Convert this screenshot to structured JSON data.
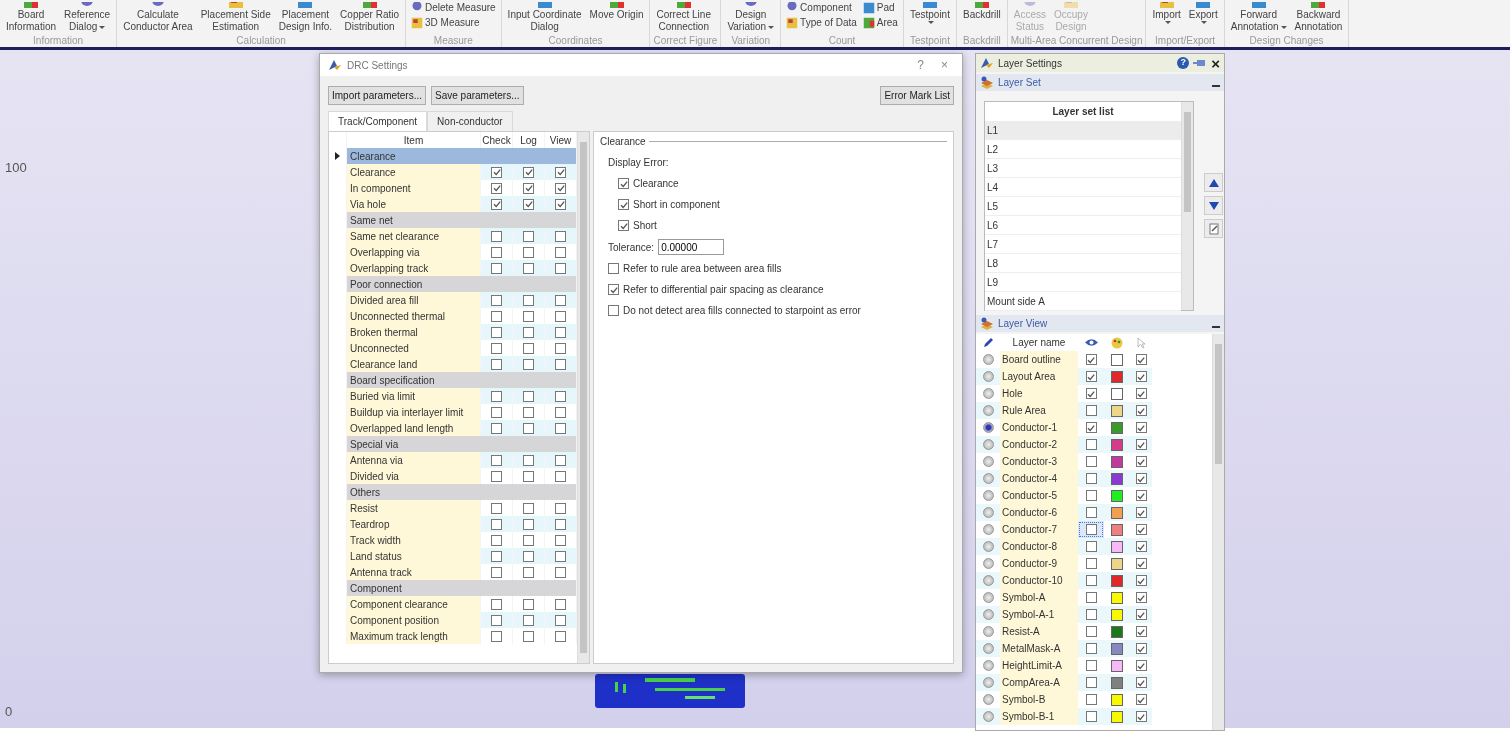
{
  "ribbon": {
    "groups": [
      {
        "title": "Information",
        "buttons": [
          {
            "kind": "large",
            "lines": [
              "Board",
              "Information"
            ],
            "dropdown": false,
            "disabled": false
          },
          {
            "kind": "large",
            "lines": [
              "Reference",
              "Dialog"
            ],
            "dropdown": true,
            "disabled": false
          }
        ]
      },
      {
        "title": "Calculation",
        "buttons": [
          {
            "kind": "large",
            "lines": [
              "Calculate",
              "Conductor Area"
            ],
            "dropdown": false,
            "disabled": false
          },
          {
            "kind": "large",
            "lines": [
              "Placement Side",
              "Estimation"
            ],
            "dropdown": false,
            "disabled": false
          },
          {
            "kind": "large",
            "lines": [
              "Placement",
              "Design Info."
            ],
            "dropdown": false,
            "disabled": false
          },
          {
            "kind": "large",
            "lines": [
              "Copper Ratio",
              "Distribution"
            ],
            "dropdown": false,
            "disabled": false
          }
        ]
      },
      {
        "title": "Measure",
        "buttons": [
          {
            "kind": "small",
            "lines": [
              "Delete Measure"
            ],
            "dropdown": false,
            "disabled": false
          },
          {
            "kind": "small",
            "lines": [
              "3D Measure"
            ],
            "dropdown": false,
            "disabled": false
          }
        ]
      },
      {
        "title": "Coordinates",
        "buttons": [
          {
            "kind": "large",
            "lines": [
              "Input Coordinate",
              "Dialog"
            ],
            "dropdown": false,
            "disabled": false
          },
          {
            "kind": "large",
            "lines": [
              "Move Origin"
            ],
            "dropdown": false,
            "disabled": false
          }
        ]
      },
      {
        "title": "Correct Figure",
        "buttons": [
          {
            "kind": "large",
            "lines": [
              "Correct Line",
              "Connection"
            ],
            "dropdown": false,
            "disabled": false
          }
        ]
      },
      {
        "title": "Variation",
        "buttons": [
          {
            "kind": "large",
            "lines": [
              "Design",
              "Variation"
            ],
            "dropdown": true,
            "disabled": false
          }
        ]
      },
      {
        "title": "Count",
        "buttons": [
          {
            "kind": "small",
            "lines": [
              "Component"
            ],
            "dropdown": false,
            "disabled": false
          },
          {
            "kind": "small",
            "lines": [
              "Type of Data"
            ],
            "dropdown": false,
            "disabled": false
          },
          {
            "kind": "small",
            "lines": [
              "Pad"
            ],
            "dropdown": false,
            "disabled": false
          },
          {
            "kind": "small",
            "lines": [
              "Area"
            ],
            "dropdown": false,
            "disabled": false
          }
        ]
      },
      {
        "title": "Testpoint",
        "buttons": [
          {
            "kind": "large",
            "lines": [
              "Testpoint"
            ],
            "dropdown": true,
            "disabled": false
          }
        ]
      },
      {
        "title": "Backdrill",
        "buttons": [
          {
            "kind": "large",
            "lines": [
              "Backdrill"
            ],
            "dropdown": false,
            "disabled": false
          }
        ]
      },
      {
        "title": "Multi-Area Concurrent Design",
        "buttons": [
          {
            "kind": "large",
            "lines": [
              "Access",
              "Status"
            ],
            "dropdown": false,
            "disabled": true
          },
          {
            "kind": "large",
            "lines": [
              "Occupy",
              "Design"
            ],
            "dropdown": false,
            "disabled": true
          }
        ]
      },
      {
        "title": "Import/Export",
        "buttons": [
          {
            "kind": "large",
            "lines": [
              "Import"
            ],
            "dropdown": true,
            "disabled": false
          },
          {
            "kind": "large",
            "lines": [
              "Export"
            ],
            "dropdown": true,
            "disabled": false
          }
        ]
      },
      {
        "title": "Design Changes",
        "buttons": [
          {
            "kind": "large",
            "lines": [
              "Forward",
              "Annotation"
            ],
            "dropdown": true,
            "disabled": false
          },
          {
            "kind": "large",
            "lines": [
              "Backward",
              "Annotation"
            ],
            "dropdown": false,
            "disabled": false
          }
        ]
      }
    ]
  },
  "canvas": {
    "ruler_labels": [
      "100",
      "0"
    ]
  },
  "drc_dialog": {
    "title": "DRC Settings",
    "help": "?",
    "close": "×",
    "buttons": [
      {
        "label": "Import parameters..."
      },
      {
        "label": "Save parameters..."
      }
    ],
    "error_mark_button": "Error Mark List",
    "tabs": [
      {
        "label": "Track/Component",
        "selected": true
      },
      {
        "label": "Non-conductor",
        "selected": false
      }
    ],
    "columns": [
      "Item",
      "Check",
      "Log",
      "View"
    ],
    "rows": [
      {
        "kind": "group",
        "label": "Clearance",
        "selected": true
      },
      {
        "kind": "item",
        "label": "Clearance",
        "selected": false,
        "check": true,
        "log": true,
        "view": true
      },
      {
        "kind": "item",
        "label": "In component",
        "selected": false,
        "check": true,
        "log": true,
        "view": true
      },
      {
        "kind": "item",
        "label": "Via hole",
        "selected": false,
        "check": true,
        "log": true,
        "view": true
      },
      {
        "kind": "group",
        "label": "Same net",
        "selected": false
      },
      {
        "kind": "item",
        "label": "Same net clearance",
        "selected": false,
        "check": false,
        "log": false,
        "view": false
      },
      {
        "kind": "item",
        "label": "Overlapping via",
        "selected": false,
        "check": false,
        "log": false,
        "view": false
      },
      {
        "kind": "item",
        "label": "Overlapping track",
        "selected": false,
        "check": false,
        "log": false,
        "view": false
      },
      {
        "kind": "group",
        "label": "Poor connection",
        "selected": false
      },
      {
        "kind": "item",
        "label": "Divided area fill",
        "selected": false,
        "check": false,
        "log": false,
        "view": false
      },
      {
        "kind": "item",
        "label": "Unconnected thermal",
        "selected": false,
        "check": false,
        "log": false,
        "view": false
      },
      {
        "kind": "item",
        "label": "Broken thermal",
        "selected": false,
        "check": false,
        "log": false,
        "view": false
      },
      {
        "kind": "item",
        "label": "Unconnected",
        "selected": false,
        "check": false,
        "log": false,
        "view": false
      },
      {
        "kind": "item",
        "label": "Clearance land",
        "selected": false,
        "check": false,
        "log": false,
        "view": false
      },
      {
        "kind": "group",
        "label": "Board specification",
        "selected": false
      },
      {
        "kind": "item",
        "label": "Buried via limit",
        "selected": false,
        "check": false,
        "log": false,
        "view": false
      },
      {
        "kind": "item",
        "label": "Buildup via interlayer limit",
        "selected": false,
        "check": false,
        "log": false,
        "view": false
      },
      {
        "kind": "item",
        "label": "Overlapped land length",
        "selected": false,
        "check": false,
        "log": false,
        "view": false
      },
      {
        "kind": "group",
        "label": "Special via",
        "selected": false
      },
      {
        "kind": "item",
        "label": "Antenna via",
        "selected": false,
        "check": false,
        "log": false,
        "view": false
      },
      {
        "kind": "item",
        "label": "Divided via",
        "selected": false,
        "check": false,
        "log": false,
        "view": false
      },
      {
        "kind": "group",
        "label": "Others",
        "selected": false
      },
      {
        "kind": "item",
        "label": "Resist",
        "selected": false,
        "check": false,
        "log": false,
        "view": false
      },
      {
        "kind": "item",
        "label": "Teardrop",
        "selected": false,
        "check": false,
        "log": false,
        "view": false
      },
      {
        "kind": "item",
        "label": "Track width",
        "selected": false,
        "check": false,
        "log": false,
        "view": false
      },
      {
        "kind": "item",
        "label": "Land status",
        "selected": false,
        "check": false,
        "log": false,
        "view": false
      },
      {
        "kind": "item",
        "label": "Antenna track",
        "selected": false,
        "check": false,
        "log": false,
        "view": false
      },
      {
        "kind": "group",
        "label": "Component",
        "selected": false
      },
      {
        "kind": "item",
        "label": "Component clearance",
        "selected": false,
        "check": false,
        "log": false,
        "view": false
      },
      {
        "kind": "item",
        "label": "Component position",
        "selected": false,
        "check": false,
        "log": false,
        "view": false
      },
      {
        "kind": "item",
        "label": "Maximum track length",
        "selected": false,
        "check": false,
        "log": false,
        "view": false
      }
    ],
    "panel": {
      "legend": "Clearance",
      "display_error_label": "Display Error:",
      "display_error": [
        {
          "label": "Clearance",
          "checked": true
        },
        {
          "label": "Short in component",
          "checked": true
        },
        {
          "label": "Short",
          "checked": true
        }
      ],
      "tolerance_label": "Tolerance:",
      "tolerance_value": "0.00000",
      "options": [
        {
          "label": "Refer to rule area between area fills",
          "checked": false
        },
        {
          "label": "Refer to differential pair spacing as clearance",
          "checked": true
        },
        {
          "label": "Do not detect area fills connected to starpoint as error",
          "checked": false
        }
      ]
    }
  },
  "layer_settings": {
    "title": "Layer Settings",
    "help": "?",
    "close": "×",
    "layer_set": {
      "title": "Layer Set",
      "header": "Layer set list",
      "items": [
        {
          "label": "L1",
          "selected": true
        },
        {
          "label": "L2",
          "selected": false
        },
        {
          "label": "L3",
          "selected": false
        },
        {
          "label": "L4",
          "selected": false
        },
        {
          "label": "L5",
          "selected": false
        },
        {
          "label": "L6",
          "selected": false
        },
        {
          "label": "L7",
          "selected": false
        },
        {
          "label": "L8",
          "selected": false
        },
        {
          "label": "L9",
          "selected": false
        },
        {
          "label": "Mount side A",
          "selected": false
        }
      ]
    },
    "layer_view": {
      "title": "Layer View",
      "name_header": "Layer name",
      "rows": [
        {
          "name": "Board outline",
          "active": false,
          "visible": true,
          "color": "#ffffff",
          "selectable": true,
          "focused": false
        },
        {
          "name": "Layout Area",
          "active": false,
          "visible": true,
          "color": "#e02828",
          "selectable": true,
          "focused": false
        },
        {
          "name": "Hole",
          "active": false,
          "visible": true,
          "color": "#ffffff",
          "selectable": true,
          "focused": false
        },
        {
          "name": "Rule Area",
          "active": false,
          "visible": false,
          "color": "#ecd68a",
          "selectable": true,
          "focused": false
        },
        {
          "name": "Conductor-1",
          "active": true,
          "visible": true,
          "color": "#3a9a2a",
          "selectable": true,
          "focused": false
        },
        {
          "name": "Conductor-2",
          "active": false,
          "visible": false,
          "color": "#d63a8a",
          "selectable": true,
          "focused": false
        },
        {
          "name": "Conductor-3",
          "active": false,
          "visible": false,
          "color": "#c03aa0",
          "selectable": true,
          "focused": false
        },
        {
          "name": "Conductor-4",
          "active": false,
          "visible": false,
          "color": "#8a3ad0",
          "selectable": true,
          "focused": false
        },
        {
          "name": "Conductor-5",
          "active": false,
          "visible": false,
          "color": "#20f020",
          "selectable": true,
          "focused": false
        },
        {
          "name": "Conductor-6",
          "active": false,
          "visible": false,
          "color": "#f0a050",
          "selectable": true,
          "focused": false
        },
        {
          "name": "Conductor-7",
          "active": false,
          "visible": false,
          "color": "#f08080",
          "selectable": true,
          "focused": true
        },
        {
          "name": "Conductor-8",
          "active": false,
          "visible": false,
          "color": "#f8b8f8",
          "selectable": true,
          "focused": false
        },
        {
          "name": "Conductor-9",
          "active": false,
          "visible": false,
          "color": "#ecd68a",
          "selectable": true,
          "focused": false
        },
        {
          "name": "Conductor-10",
          "active": false,
          "visible": false,
          "color": "#e02828",
          "selectable": true,
          "focused": false
        },
        {
          "name": "Symbol-A",
          "active": false,
          "visible": false,
          "color": "#f8f800",
          "selectable": true,
          "focused": false
        },
        {
          "name": "Symbol-A-1",
          "active": false,
          "visible": false,
          "color": "#f8f800",
          "selectable": true,
          "focused": false
        },
        {
          "name": "Resist-A",
          "active": false,
          "visible": false,
          "color": "#1a7a1a",
          "selectable": true,
          "focused": false
        },
        {
          "name": "MetalMask-A",
          "active": false,
          "visible": false,
          "color": "#8888c0",
          "selectable": true,
          "focused": false
        },
        {
          "name": "HeightLimit-A",
          "active": false,
          "visible": false,
          "color": "#f8b8f8",
          "selectable": true,
          "focused": false
        },
        {
          "name": "CompArea-A",
          "active": false,
          "visible": false,
          "color": "#808080",
          "selectable": true,
          "focused": false
        },
        {
          "name": "Symbol-B",
          "active": false,
          "visible": false,
          "color": "#f8f800",
          "selectable": true,
          "focused": false
        },
        {
          "name": "Symbol-B-1",
          "active": false,
          "visible": false,
          "color": "#f8f800",
          "selectable": true,
          "focused": false
        }
      ]
    }
  }
}
